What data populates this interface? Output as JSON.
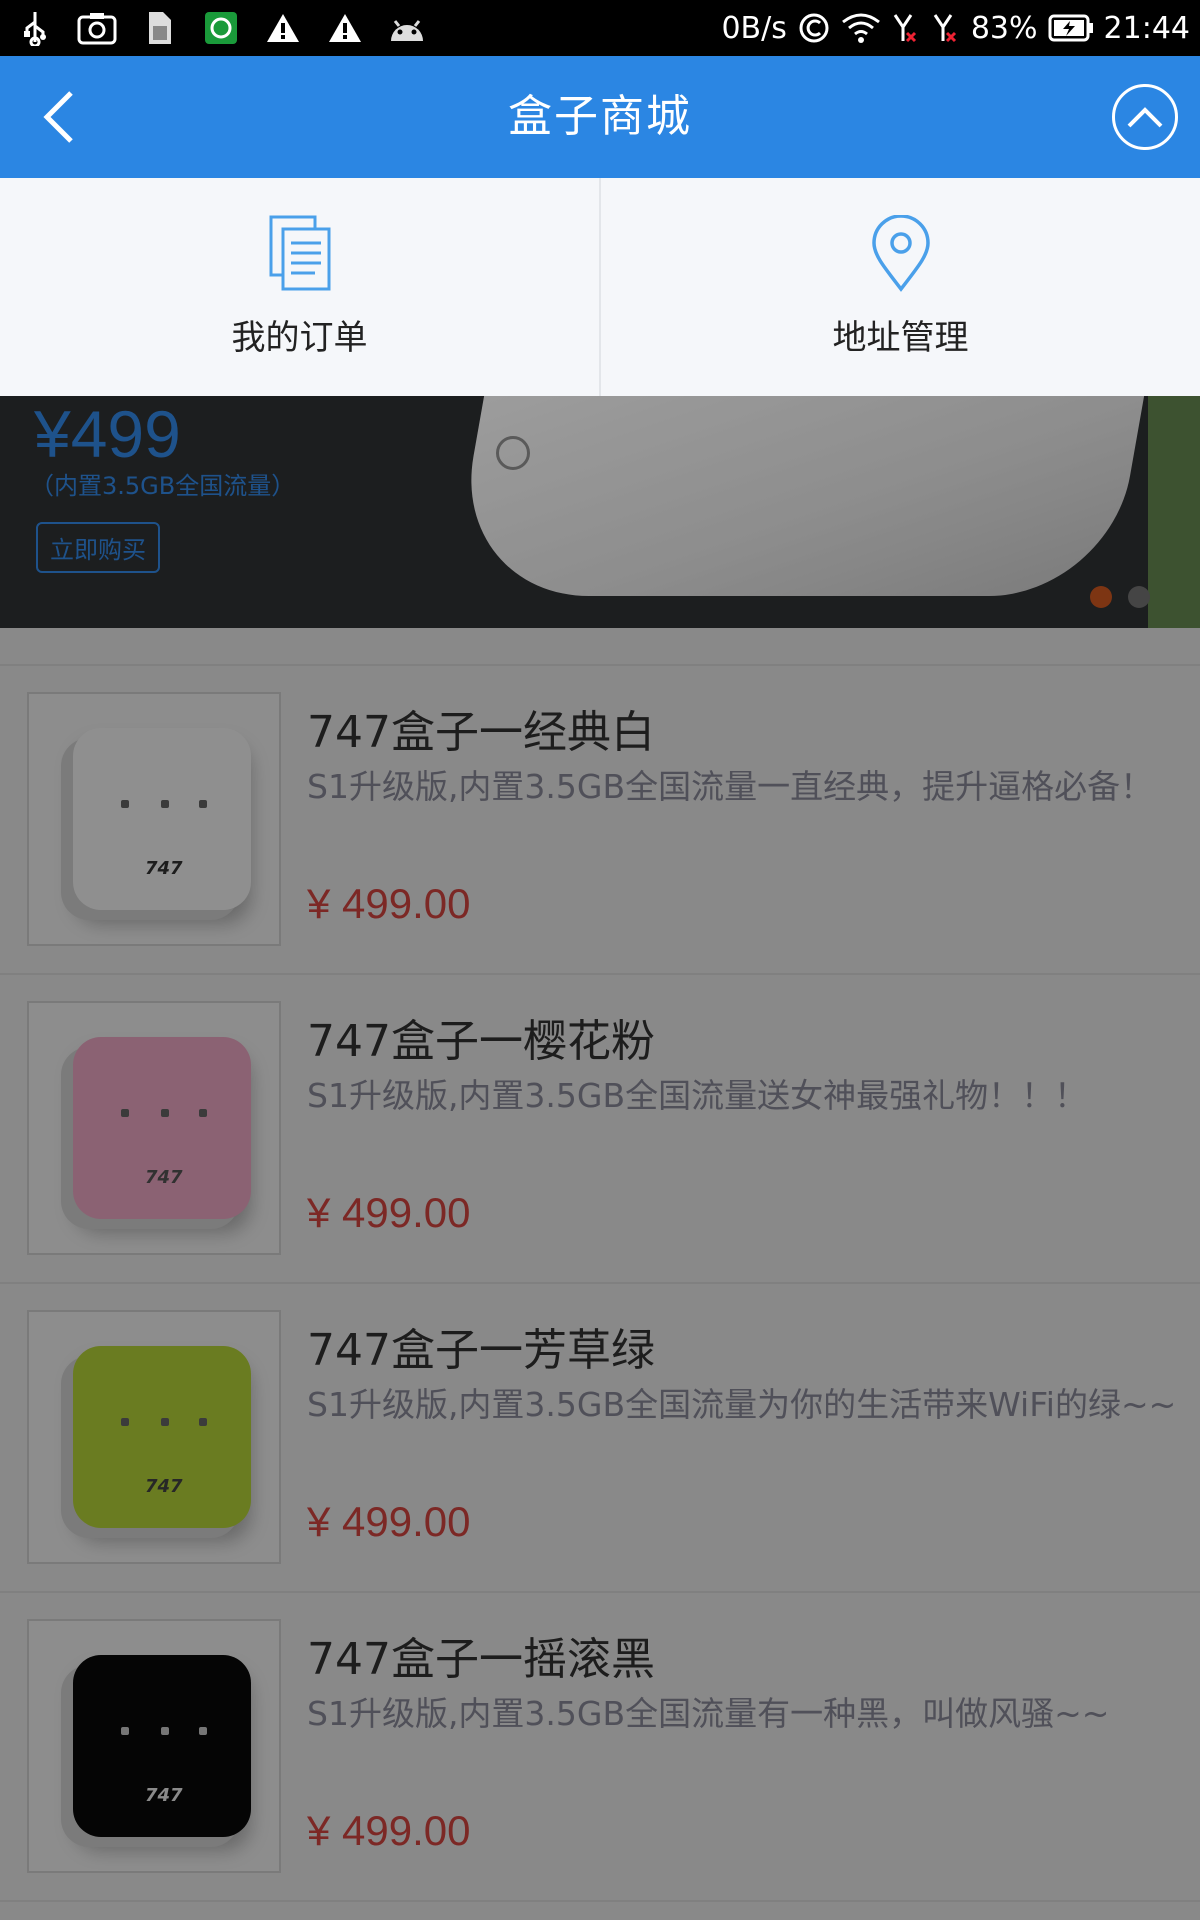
{
  "status_bar": {
    "speed": "0B/s",
    "battery": "83%",
    "time": "21:44"
  },
  "header": {
    "title": "盒子商城"
  },
  "quick": [
    {
      "label": "我的订单",
      "icon": "document-icon"
    },
    {
      "label": "地址管理",
      "icon": "location-pin-icon"
    }
  ],
  "banner": {
    "price": "¥499",
    "subtitle": "（内置3.5GB全国流量）",
    "button": "立即购买",
    "slides_total": 2,
    "active_slide": 1
  },
  "products": [
    {
      "title": "747盒子一经典白",
      "desc": "S1升级版,内置3.5GB全国流量一直经典，提升逼格必备！",
      "price": "¥ 499.00",
      "color": "#f5f5f5"
    },
    {
      "title": "747盒子一樱花粉",
      "desc": "S1升级版,内置3.5GB全国流量送女神最强礼物！！！",
      "price": "¥ 499.00",
      "color": "#f0a9c6"
    },
    {
      "title": "747盒子一芳草绿",
      "desc": "S1升级版,内置3.5GB全国流量为你的生活带来WiFi的绿~~",
      "price": "¥ 499.00",
      "color": "#b7d63a"
    },
    {
      "title": "747盒子一摇滚黑",
      "desc": "S1升级版,内置3.5GB全国流量有一种黑，叫做风骚~~",
      "price": "¥ 499.00",
      "color": "#0a0a0a"
    }
  ],
  "colors": {
    "accent": "#2b86e3",
    "price": "#d64541"
  }
}
